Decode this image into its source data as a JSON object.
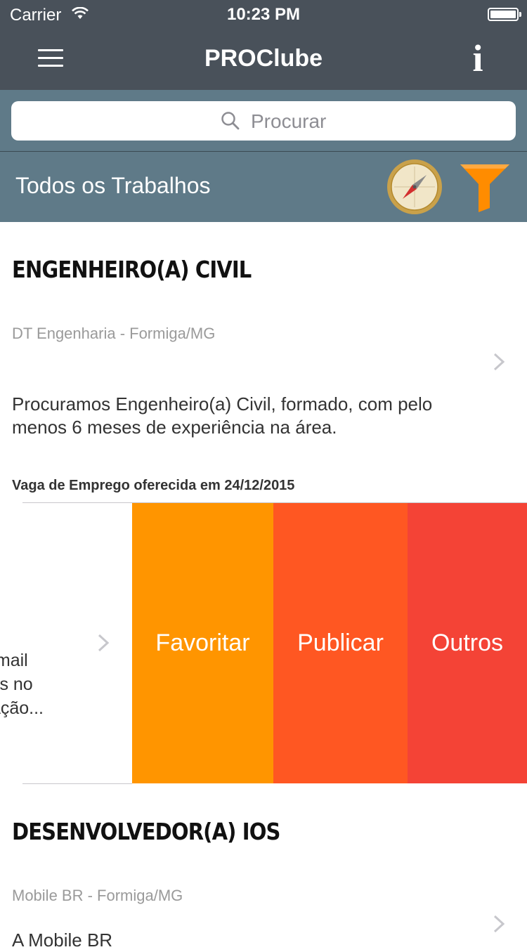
{
  "status_bar": {
    "carrier": "Carrier",
    "time": "10:23 PM"
  },
  "nav": {
    "title": "PROClube",
    "info_glyph": "i",
    "menu_icon": "hamburger-icon",
    "info_icon": "info-icon"
  },
  "search": {
    "placeholder": "Procurar"
  },
  "section": {
    "title": "Todos os Trabalhos",
    "compass_icon": "compass-icon",
    "filter_icon": "funnel-icon"
  },
  "jobs": [
    {
      "title": "ENGENHEIRO(A) CIVIL",
      "company": "DT Engenharia - Formiga/MG",
      "description": "Procuramos Engenheiro(a) Civil, formado, com pelo menos 6 meses de experiência na área.",
      "date": "Vaga de Emprego oferecida em 24/12/2015"
    },
    {
      "title": "DESENVOLVEDOR(A) IOS",
      "company": "Mobile BR - Formiga/MG",
      "description_partial": "A Mobile BR"
    }
  ],
  "swiped_row": {
    "text_lines": [
      "email",
      "sts no",
      "tação..."
    ],
    "actions": [
      {
        "label": "Favoritar",
        "color": "#ff9500"
      },
      {
        "label": "Publicar",
        "color": "#ff5722"
      },
      {
        "label": "Outros",
        "color": "#f44336"
      }
    ]
  },
  "colors": {
    "nav_bg": "#49515a",
    "header_bg": "#5f7a88",
    "accent_orange": "#ff8c00"
  }
}
